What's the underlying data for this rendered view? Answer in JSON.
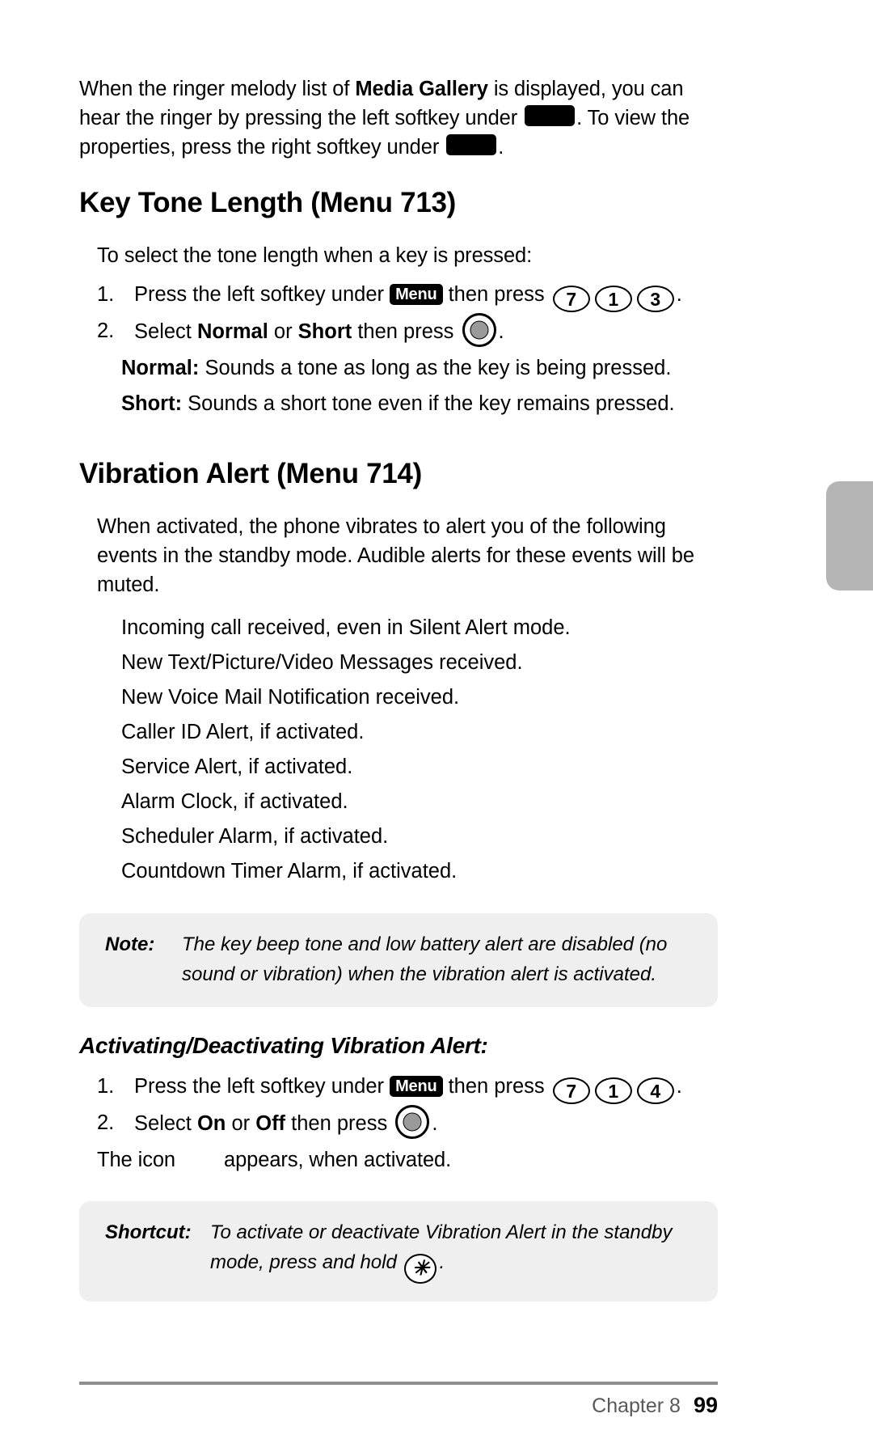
{
  "page": {
    "number": "99",
    "chapter_label": "Chapter 8"
  },
  "intro": {
    "part1": "When the ringer melody list of ",
    "bold1": "Media Gallery",
    "part2": " is displayed, you can hear the ringer by pressing the left softkey under ",
    "part3": ". To view the properties, press the right softkey under ",
    "part4": "."
  },
  "section_key_tone": {
    "title": "Key Tone Length (Menu 713)",
    "lead": "To select the tone length when a key is pressed:",
    "steps": [
      {
        "num": "1.",
        "t1": "Press the left softkey under ",
        "softkey": "Menu",
        "t2": " then press ",
        "keys": [
          "7",
          "1",
          "3"
        ],
        "t3": "."
      },
      {
        "num": "2.",
        "t1": "Select ",
        "b1": "Normal",
        "t2": " or ",
        "b2": "Short",
        "t3": " then press ",
        "t4": "."
      }
    ],
    "definitions": [
      {
        "term": "Normal:",
        "text": " Sounds a tone as long as the key is being pressed."
      },
      {
        "term": "Short:",
        "text": " Sounds a short tone even if the key remains pressed."
      }
    ]
  },
  "section_vibration": {
    "title": "Vibration Alert (Menu 714)",
    "intro": "When activated, the phone vibrates to alert you of the following events in the standby mode. Audible alerts for these events will be muted.",
    "events": [
      "Incoming call received, even in Silent Alert mode.",
      "New Text/Picture/Video Messages received.",
      "New Voice Mail Notification received.",
      "Caller ID Alert, if activated.",
      "Service Alert, if activated.",
      "Alarm Clock, if activated.",
      "Scheduler Alarm, if activated.",
      "Countdown Timer Alarm, if activated."
    ],
    "note": {
      "label": "Note:",
      "text": "The key beep tone and low battery alert are disabled (no sound or vibration) when the vibration alert is activated."
    },
    "subsection_title": "Activating/Deactivating Vibration Alert:",
    "steps": [
      {
        "num": "1.",
        "t1": "Press the left softkey under ",
        "softkey": "Menu",
        "t2": " then press ",
        "keys": [
          "7",
          "1",
          "4"
        ],
        "t3": "."
      },
      {
        "num": "2.",
        "t1": "Select ",
        "b1": "On",
        "t2": " or ",
        "b2": "Off",
        "t3": " then press ",
        "t4": "."
      }
    ],
    "icon_line": {
      "t1": "The icon",
      "t2": "appears, when activated."
    },
    "shortcut": {
      "label": "Shortcut:",
      "t1": "To activate or deactivate Vibration Alert in the standby mode, press and hold ",
      "key": "✳",
      "t2": "."
    }
  },
  "colors": {
    "callout_bg": "#efefef",
    "tab_gray": "#b5b5b5",
    "footer_rule": "#8f8f8f",
    "chapter_text": "#595959",
    "ok_key_fill": "#9a9a9a"
  }
}
